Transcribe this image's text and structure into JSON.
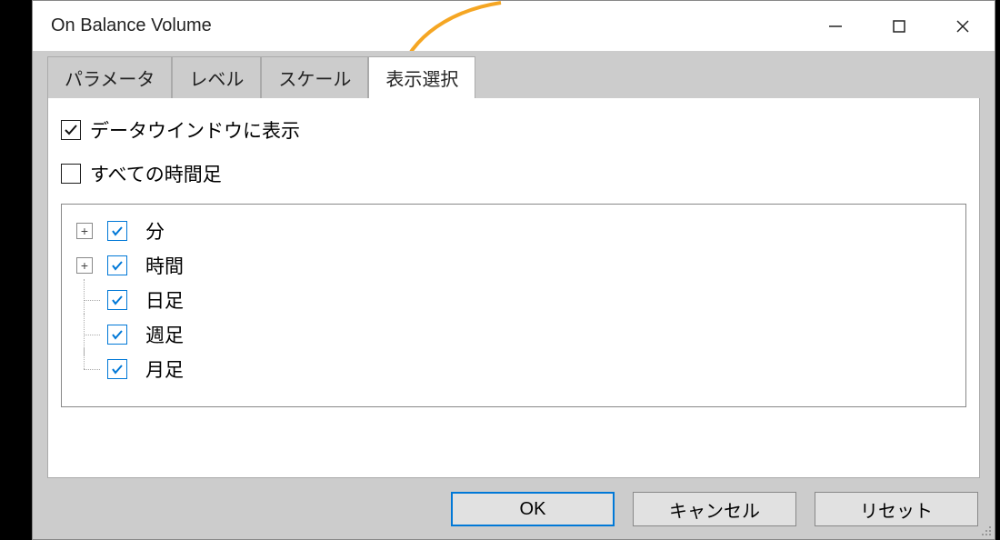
{
  "window": {
    "title": "On Balance Volume"
  },
  "tabs": {
    "parameters": "パラメータ",
    "levels": "レベル",
    "scale": "スケール",
    "display": "表示選択",
    "active": "display"
  },
  "options": {
    "show_in_data_window": {
      "label": "データウインドウに表示",
      "checked": true
    },
    "all_timeframes": {
      "label": "すべての時間足",
      "checked": false
    }
  },
  "tree": [
    {
      "label": "分",
      "checked": true,
      "expandable": true
    },
    {
      "label": "時間",
      "checked": true,
      "expandable": true
    },
    {
      "label": "日足",
      "checked": true,
      "expandable": false
    },
    {
      "label": "週足",
      "checked": true,
      "expandable": false
    },
    {
      "label": "月足",
      "checked": true,
      "expandable": false
    }
  ],
  "buttons": {
    "ok": "OK",
    "cancel": "キャンセル",
    "reset": "リセット"
  },
  "icons": {
    "checkmark_color": "#0078d7"
  }
}
